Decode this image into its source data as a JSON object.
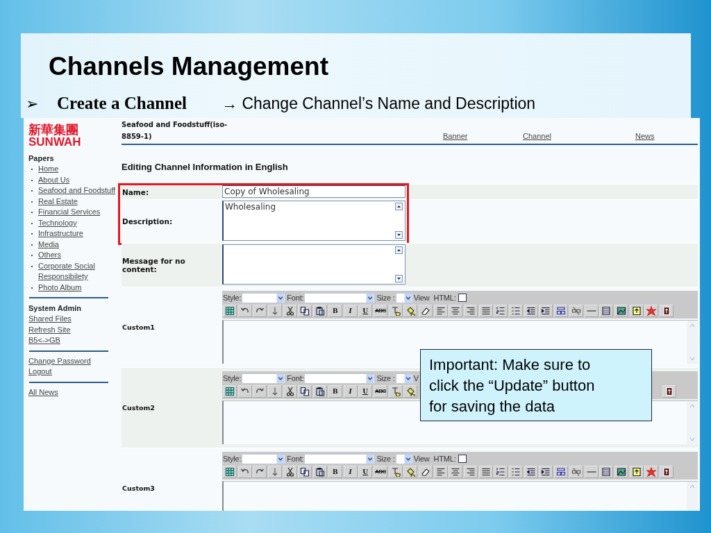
{
  "slide": {
    "title": "Channels Management",
    "bullet_marker": "➢",
    "bullet": "Create a Channel",
    "arrow": "→",
    "note": "Change Channel’s Name and Description"
  },
  "site": {
    "logo_chinese": "新華集團",
    "logo_latin": "SUNWAH",
    "page_title_lines": [
      "Seafood and Foodstuff(iso-",
      "8859-1)"
    ],
    "nav": [
      "Banner",
      "Channel",
      "News"
    ],
    "heading": "Editing Channel Information in English"
  },
  "sidebar": [
    {
      "heading": "Papers",
      "kind": "bulleted",
      "items": [
        "Home",
        "About Us",
        "Seafood and Foodstuff",
        "Real Estate",
        "Financial Services",
        "Technology",
        "Infrastructure",
        "Media",
        "Others",
        "Corporate Social Responsibilety",
        "Photo Album"
      ]
    },
    {
      "heading": "System Admin",
      "kind": "plain",
      "items": [
        "Shared Files",
        "Refresh Site",
        "B5<->GB"
      ]
    },
    {
      "kind": "plain",
      "items": [
        "Change Password",
        "Logout"
      ]
    },
    {
      "kind": "plain",
      "items": [
        "All News"
      ]
    }
  ],
  "fields": [
    {
      "label": "Name:",
      "kind": "input",
      "value": "Copy of Wholesaling",
      "highlighted": true
    },
    {
      "label": "Description:",
      "kind": "textarea",
      "value": "Wholesaling",
      "highlighted": true
    },
    {
      "label": "Message for no content:",
      "kind": "textarea",
      "highlighted": false
    }
  ],
  "editors": [
    {
      "label": "Custom1",
      "style_label": "Style:",
      "font_label": "Font:",
      "size_label": "Size :",
      "view_label": "View",
      "html_label": "HTML:",
      "html_checked": false,
      "tools": [
        {
          "kind": "table"
        },
        {
          "kind": "undo"
        },
        {
          "kind": "redo"
        },
        {
          "kind": "down"
        },
        {
          "kind": "cut"
        },
        {
          "kind": "copy"
        },
        {
          "kind": "paste"
        },
        {
          "kind": "bold",
          "label": "B"
        },
        {
          "kind": "italic",
          "label": "I"
        },
        {
          "kind": "underline",
          "label": "U"
        },
        {
          "kind": "strike",
          "label": "ABC"
        },
        {
          "kind": "textcolor"
        },
        {
          "kind": "bgcolor"
        },
        {
          "kind": "eraser"
        },
        {
          "kind": "left"
        },
        {
          "kind": "center"
        },
        {
          "kind": "right"
        },
        {
          "kind": "justify"
        },
        {
          "kind": "ol"
        },
        {
          "kind": "ul"
        },
        {
          "kind": "outdent"
        },
        {
          "kind": "indent"
        },
        {
          "kind": "link"
        },
        {
          "kind": "unlink"
        },
        {
          "kind": "rule"
        },
        {
          "kind": "grid"
        },
        {
          "kind": "image"
        },
        {
          "kind": "upload"
        },
        {
          "kind": "flash"
        },
        {
          "kind": "special"
        }
      ]
    },
    {
      "label": "Custom2",
      "style_label": "Style:",
      "font_label": "Font:",
      "size_label": "Size :",
      "view_label": "V",
      "tools": [
        {
          "kind": "table"
        },
        {
          "kind": "undo"
        },
        {
          "kind": "redo"
        },
        {
          "kind": "down"
        },
        {
          "kind": "cut"
        },
        {
          "kind": "copy"
        },
        {
          "kind": "paste"
        },
        {
          "kind": "bold",
          "label": "B"
        },
        {
          "kind": "italic",
          "label": "I"
        },
        {
          "kind": "underline",
          "label": "U"
        },
        {
          "kind": "strike",
          "label": "ABC"
        },
        {
          "kind": "textcolor"
        },
        {
          "kind": "bgcolor"
        },
        {
          "kind": "covered"
        },
        {
          "kind": "special"
        }
      ]
    },
    {
      "label": "Custom3",
      "style_label": "Style:",
      "font_label": "Font:",
      "size_label": "Size :",
      "view_label": "View",
      "html_label": "HTML:",
      "html_checked": false,
      "tools": [
        {
          "kind": "table"
        },
        {
          "kind": "undo"
        },
        {
          "kind": "redo"
        },
        {
          "kind": "down"
        },
        {
          "kind": "cut"
        },
        {
          "kind": "copy"
        },
        {
          "kind": "paste"
        },
        {
          "kind": "bold",
          "label": "B"
        },
        {
          "kind": "italic",
          "label": "I"
        },
        {
          "kind": "underline",
          "label": "U"
        },
        {
          "kind": "strike",
          "label": "ABC"
        },
        {
          "kind": "textcolor"
        },
        {
          "kind": "bgcolor"
        },
        {
          "kind": "eraser"
        },
        {
          "kind": "left"
        },
        {
          "kind": "center"
        },
        {
          "kind": "right"
        },
        {
          "kind": "justify"
        },
        {
          "kind": "ol"
        },
        {
          "kind": "ul"
        },
        {
          "kind": "outdent"
        },
        {
          "kind": "indent"
        },
        {
          "kind": "link"
        },
        {
          "kind": "unlink"
        },
        {
          "kind": "rule"
        },
        {
          "kind": "grid"
        },
        {
          "kind": "image"
        },
        {
          "kind": "upload"
        },
        {
          "kind": "flash"
        },
        {
          "kind": "special"
        }
      ]
    }
  ],
  "callout": {
    "text": "Important: Make sure to click the “Update” button for saving the data"
  }
}
